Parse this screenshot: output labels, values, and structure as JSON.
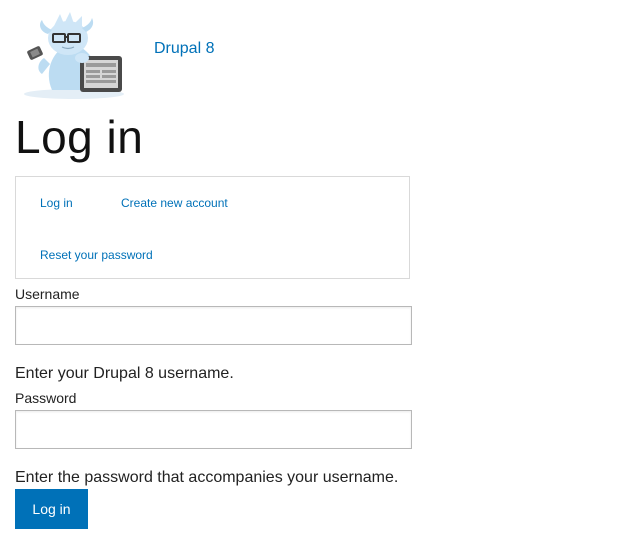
{
  "header": {
    "site_name": "Drupal 8",
    "logo_icon": "drupal-mascot-icon"
  },
  "page": {
    "title": "Log in"
  },
  "tabs": {
    "login": "Log in",
    "create_account": "Create new account",
    "reset_password": "Reset your password"
  },
  "form": {
    "username_label": "Username",
    "username_value": "",
    "username_description": "Enter your Drupal 8 username.",
    "password_label": "Password",
    "password_value": "",
    "password_description": "Enter the password that accompanies your username.",
    "submit_label": "Log in"
  },
  "colors": {
    "link": "#0071b8",
    "button": "#0071b8"
  }
}
